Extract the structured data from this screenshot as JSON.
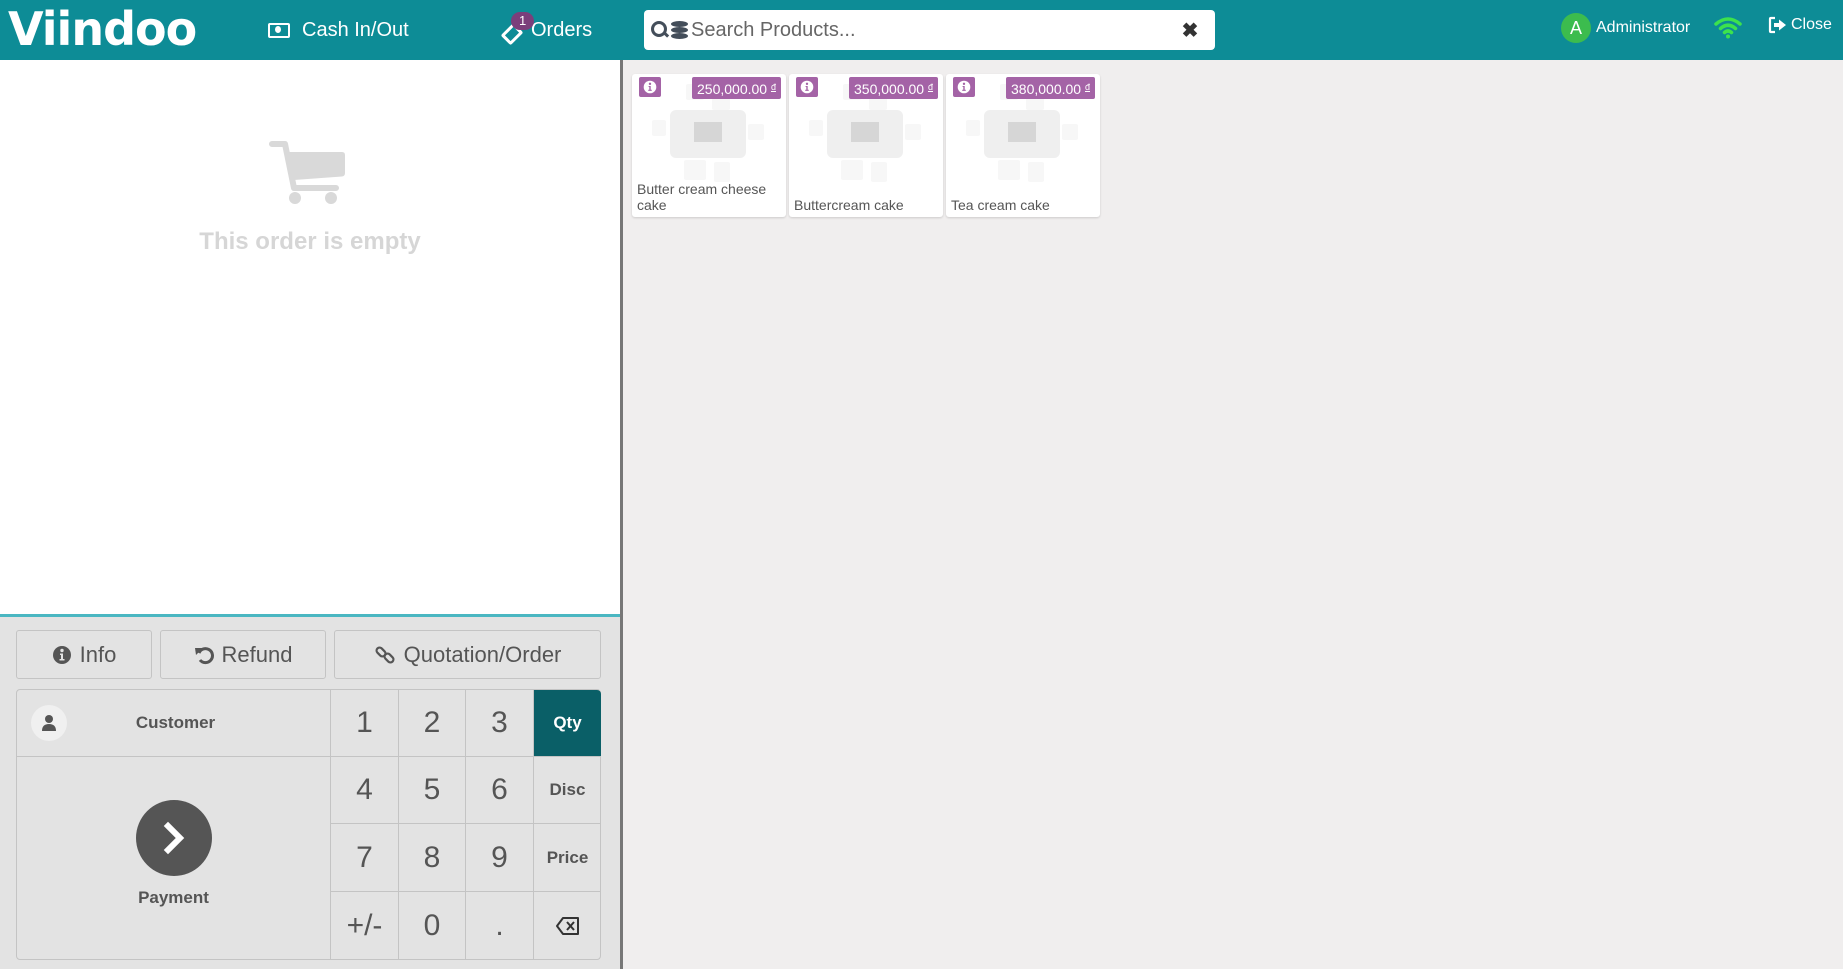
{
  "header": {
    "logo": "Viindoo",
    "cash_label": "Cash In/Out",
    "orders_label": "Orders",
    "orders_badge": "1",
    "search": {
      "placeholder": "Search Products...",
      "value": ""
    },
    "user": {
      "initial": "A",
      "name": "Administrator"
    },
    "close_label": "Close",
    "colors": {
      "bar": "#0d8c96",
      "avatar": "#3cbc4e",
      "wifi": "#3ce24d",
      "badge": "#7b3f7b"
    }
  },
  "order": {
    "empty_message": "This order is empty"
  },
  "controls": {
    "info_label": "Info",
    "refund_label": "Refund",
    "quotation_label": "Quotation/Order"
  },
  "numpad": {
    "customer_label": "Customer",
    "payment_label": "Payment",
    "keys": [
      "1",
      "2",
      "3",
      "Qty",
      "4",
      "5",
      "6",
      "Disc",
      "7",
      "8",
      "9",
      "Price",
      "+/-",
      "0",
      "."
    ],
    "active_mode": "Qty",
    "colors": {
      "active": "#0a5f67"
    }
  },
  "products": [
    {
      "name": "Butter cream cheese cake",
      "price": "250,000.00",
      "currency": "đ"
    },
    {
      "name": "Buttercream cake",
      "price": "350,000.00",
      "currency": "đ"
    },
    {
      "name": "Tea cream cake",
      "price": "380,000.00",
      "currency": "đ"
    }
  ],
  "price_tag_color": "#a463a6"
}
